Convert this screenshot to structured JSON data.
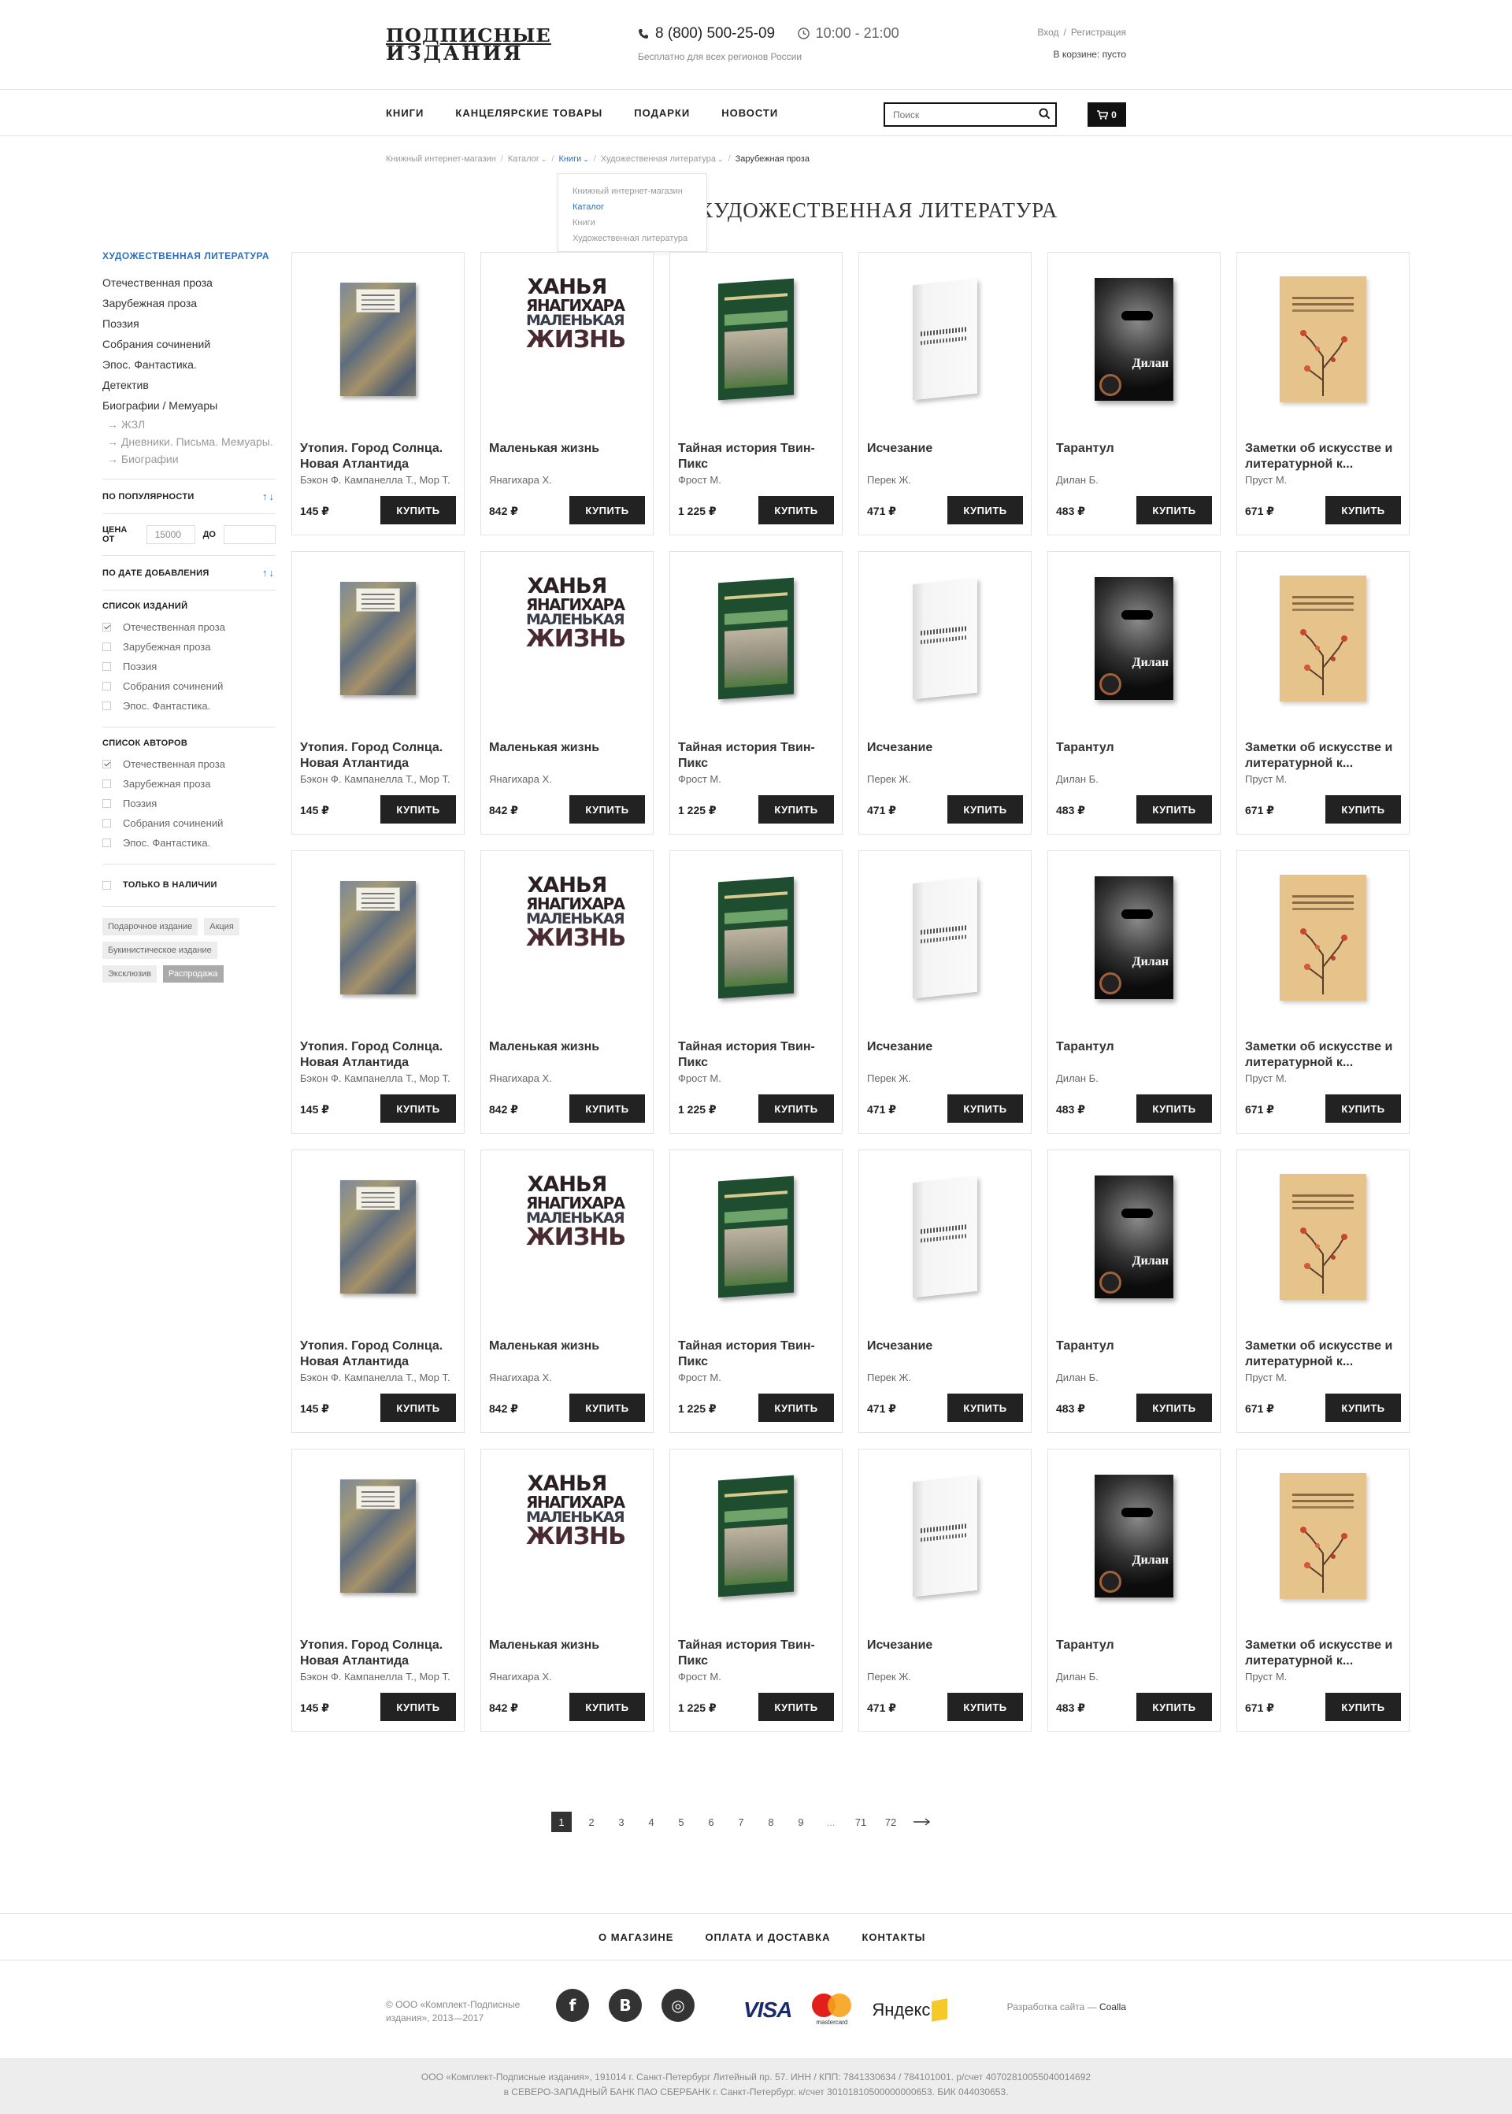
{
  "header": {
    "logo_line1": "ПОДПИСНЫЕ",
    "logo_line2": "ИЗДАНИЯ",
    "phone": "8 (800) 500-25-09",
    "hours": "10:00 - 21:00",
    "free_note": "Бесплатно для всех регионов России",
    "login": "Вход",
    "register": "Регистрация",
    "cart_status": "В корзине: пусто"
  },
  "nav": {
    "items": [
      "КНИГИ",
      "КАНЦЕЛЯРСКИЕ ТОВАРЫ",
      "ПОДАРКИ",
      "НОВОСТИ"
    ],
    "search_placeholder": "Поиск",
    "cart_count": "0"
  },
  "breadcrumb": {
    "items": [
      "Книжный интернет-магазин",
      "Каталог",
      "Книги",
      "Художественная литература",
      "Зарубежная проза"
    ],
    "dropdown": [
      "Книжный интернет-магазин",
      "Каталог",
      "Книги",
      "Художественная литература"
    ]
  },
  "page_title": "ХУДОЖЕСТВЕННАЯ ЛИТЕРАТУРА",
  "sidebar": {
    "heading": "ХУДОЖЕСТВЕННАЯ ЛИТЕРАТУРА",
    "categories": [
      "Отечественная проза",
      "Зарубежная проза",
      "Поэзия",
      "Собрания сочинений",
      "Эпос. Фантастика.",
      "Детектив",
      "Биографии / Мемуары"
    ],
    "subcategories": [
      "ЖЗЛ",
      "Дневники. Письма. Мемуары.",
      "Биографии"
    ],
    "sort_popularity": "ПО ПОПУЛЯРНОСТИ",
    "price_from_label": "ЦЕНА ОТ",
    "price_from_value": "15000",
    "price_to_label": "ДО",
    "sort_date": "ПО ДАТЕ ДОБАВЛЕНИЯ",
    "editions_title": "СПИСОК ИЗДАНИЙ",
    "editions": [
      {
        "label": "Отечественная проза",
        "checked": true
      },
      {
        "label": "Зарубежная проза",
        "checked": false
      },
      {
        "label": "Поэзия",
        "checked": false
      },
      {
        "label": "Собрания сочинений",
        "checked": false
      },
      {
        "label": "Эпос. Фантастика.",
        "checked": false
      }
    ],
    "authors_title": "СПИСОК АВТОРОВ",
    "authors": [
      {
        "label": "Отечественная проза",
        "checked": true
      },
      {
        "label": "Зарубежная проза",
        "checked": false
      },
      {
        "label": "Поэзия",
        "checked": false
      },
      {
        "label": "Собрания сочинений",
        "checked": false
      },
      {
        "label": "Эпос. Фантастика.",
        "checked": false
      }
    ],
    "in_stock": "ТОЛЬКО В НАЛИЧИИ",
    "tags": [
      "Подарочное издание",
      "Акция",
      "Букинистическое издание",
      "Эксклюзив",
      "Распродажа"
    ]
  },
  "products": [
    {
      "title": "Утопия. Город Солнца. Новая Атлантида",
      "author": "Бэкон Ф. Кампанелла Т., Мор Т.",
      "price": "145 ₽",
      "cover": "utopia"
    },
    {
      "title": "Маленькая жизнь",
      "author": "Янагихара Х.",
      "price": "842 ₽",
      "cover": "zhizn"
    },
    {
      "title": "Тайная история Твин-Пикс",
      "author": "Фрост М.",
      "price": "1 225 ₽",
      "cover": "twin"
    },
    {
      "title": "Исчезание",
      "author": "Перек Ж.",
      "price": "471 ₽",
      "cover": "ischez"
    },
    {
      "title": "Тарантул",
      "author": "Дилан Б.",
      "price": "483 ₽",
      "cover": "dylan"
    },
    {
      "title": "Заметки об искусстве и литературной к...",
      "author": "Пруст М.",
      "price": "671 ₽",
      "cover": "proust"
    }
  ],
  "cover_text": {
    "zhizn_1": "ХАНЬЯ",
    "zhizn_2": "ЯНАГИХАРА",
    "zhizn_3": "МАЛЕНЬКАЯ",
    "zhizn_4": "ЖИЗНЬ",
    "dylan": "Дилан"
  },
  "buy_label": "КУПИТЬ",
  "pagination": [
    "1",
    "2",
    "3",
    "4",
    "5",
    "6",
    "7",
    "8",
    "9",
    "...",
    "71",
    "72"
  ],
  "footer": {
    "nav": [
      "О МАГАЗИНЕ",
      "ОПЛАТА И ДОСТАВКА",
      "КОНТАКТЫ"
    ],
    "copyright": "© ООО «Комплект-Подписные издания», 2013—2017",
    "social": [
      "f",
      "В",
      "◎"
    ],
    "visa": "VISA",
    "mastercard": "mastercard",
    "yandex": "Яндекс",
    "developer_prefix": "Разработка сайта — ",
    "developer": "Coalla",
    "legal_1": "ООО «Комплект-Подписные издания», 191014 г. Санкт-Петербург Литейный пр. 57. ИНН / КПП: 7841330634 / 784101001. р/счет 40702810055040014692",
    "legal_2": "в СЕВЕРО-ЗАПАДНЫЙ БАНК ПАО СБЕРБАНК г. Санкт-Петербург. к/счет 30101810500000000653. БИК 044030653."
  },
  "colors": {
    "accent": "#2b6fbf",
    "button": "#222222",
    "legal_bg": "#ededed"
  }
}
